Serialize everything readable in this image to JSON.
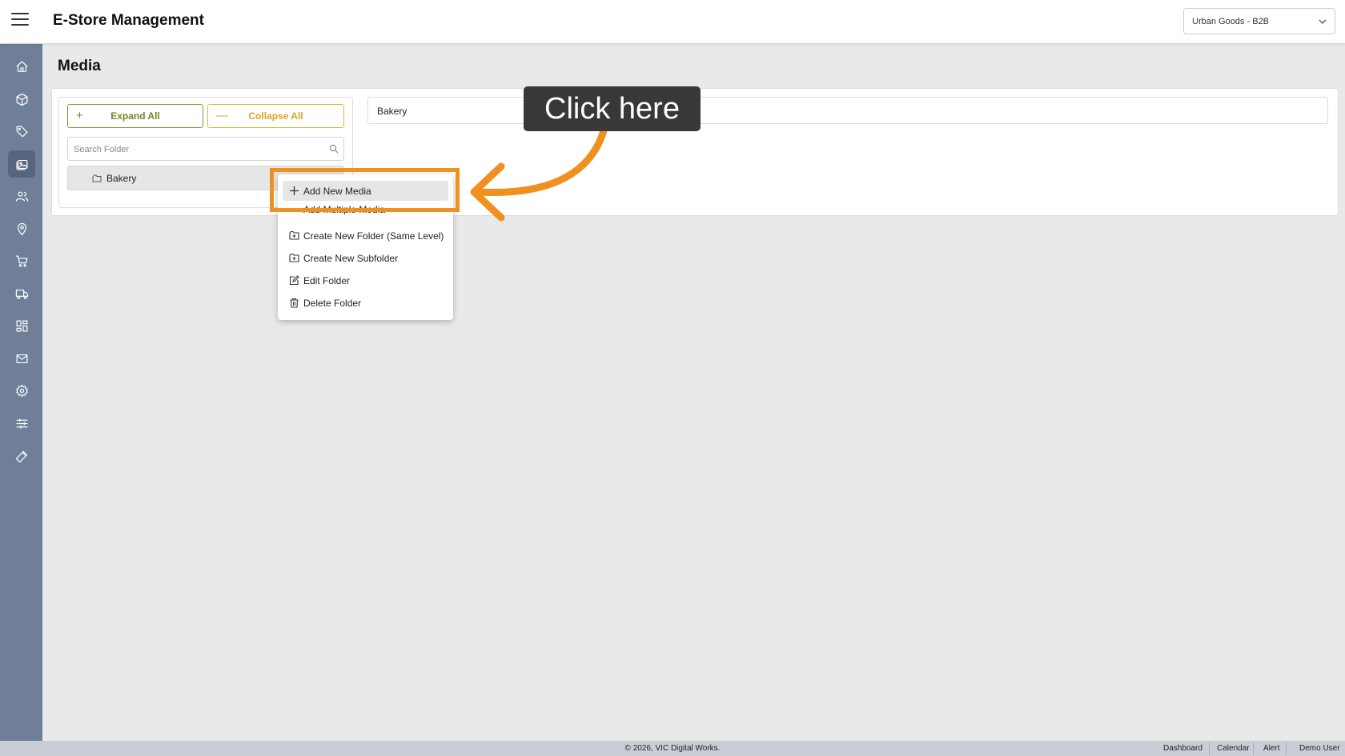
{
  "header": {
    "app_title": "E-Store Management",
    "store_selector": {
      "value": "Urban Goods - B2B"
    }
  },
  "sidebar": {
    "items": [
      {
        "icon": "home-icon"
      },
      {
        "icon": "box-icon"
      },
      {
        "icon": "tag-icon"
      },
      {
        "icon": "media-icon",
        "active": true
      },
      {
        "icon": "users-icon"
      },
      {
        "icon": "location-icon"
      },
      {
        "icon": "cart-icon"
      },
      {
        "icon": "truck-icon"
      },
      {
        "icon": "grid-icon"
      },
      {
        "icon": "mail-icon"
      },
      {
        "icon": "settings-icon"
      },
      {
        "icon": "sliders-icon"
      },
      {
        "icon": "wrench-icon"
      }
    ]
  },
  "page": {
    "title": "Media"
  },
  "tree": {
    "expand_label": "Expand All",
    "collapse_label": "Collapse All",
    "search_placeholder": "Search Folder",
    "nodes": [
      {
        "label": "Bakery"
      }
    ]
  },
  "path_field": {
    "value": "Bakery"
  },
  "context_menu": {
    "items": [
      {
        "label": "Add New Media",
        "icon": "plus-icon"
      },
      {
        "label": "Add Multiple Media",
        "icon": "plus-icon"
      },
      {
        "label": "Create New Folder (Same Level)",
        "icon": "folder-plus-icon"
      },
      {
        "label": "Create New Subfolder",
        "icon": "folder-plus-icon"
      },
      {
        "label": "Edit Folder",
        "icon": "edit-icon"
      },
      {
        "label": "Delete Folder",
        "icon": "trash-icon"
      }
    ]
  },
  "annotation": {
    "callout_text": "Click here",
    "color": "#f0901e"
  },
  "footer": {
    "copyright": "© 2026, VIC Digital Works.",
    "links": [
      "Dashboard",
      "Calendar",
      "Alert",
      "Demo User"
    ]
  },
  "colors": {
    "sidebar_bg": "#6f7f99",
    "expand_accent": "#7c9a2e",
    "collapse_accent": "#e0b43c",
    "annotation_orange": "#f0901e"
  }
}
